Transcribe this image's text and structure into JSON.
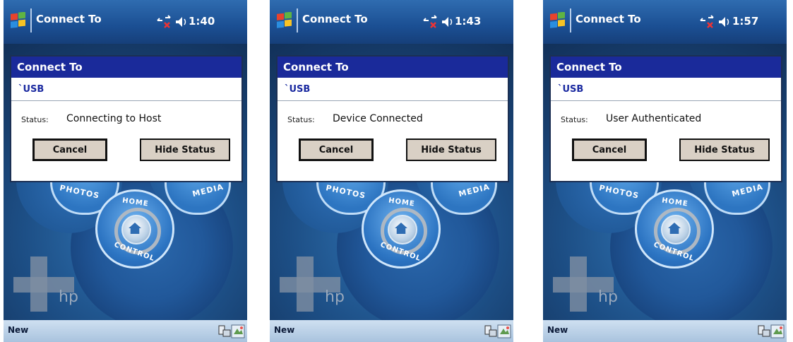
{
  "screens": [
    {
      "window_title": "Connect To",
      "clock": "1:40",
      "dialog": {
        "title": "Connect To",
        "connection_name": "`USB",
        "status_label": "Status:",
        "status_value": "Connecting to Host",
        "cancel_label": "Cancel",
        "hide_status_label": "Hide Status"
      },
      "background": {
        "photos_label": "PHOTOS",
        "media_label": "MEDIA",
        "home_label": "HOME",
        "control_label": "CONTROL",
        "brand": "hp"
      },
      "menubar": {
        "left_label": "New"
      }
    },
    {
      "window_title": "Connect To",
      "clock": "1:43",
      "dialog": {
        "title": "Connect To",
        "connection_name": "`USB",
        "status_label": "Status:",
        "status_value": "Device Connected",
        "cancel_label": "Cancel",
        "hide_status_label": "Hide Status"
      },
      "background": {
        "photos_label": "PHOTOS",
        "media_label": "MEDIA",
        "home_label": "HOME",
        "control_label": "CONTROL",
        "brand": "hp"
      },
      "menubar": {
        "left_label": "New"
      }
    },
    {
      "window_title": "Connect To",
      "clock": "1:57",
      "dialog": {
        "title": "Connect To",
        "connection_name": "`USB",
        "status_label": "Status:",
        "status_value": "User Authenticated",
        "cancel_label": "Cancel",
        "hide_status_label": "Hide Status"
      },
      "background": {
        "photos_label": "PHOTOS",
        "media_label": "MEDIA",
        "home_label": "HOME",
        "control_label": "CONTROL",
        "brand": "hp"
      },
      "menubar": {
        "left_label": "New"
      }
    }
  ],
  "colors": {
    "titlebar": "#1b4f93",
    "dialog_title": "#1a2a9a",
    "connection_text": "#1b2aa0",
    "button_face": "#d9d0c5",
    "menubar": "#bcd3ea"
  },
  "icons": [
    "windows-start-icon",
    "network-signal-icon",
    "volume-icon",
    "keyboard-icon",
    "input-panel-icon"
  ]
}
